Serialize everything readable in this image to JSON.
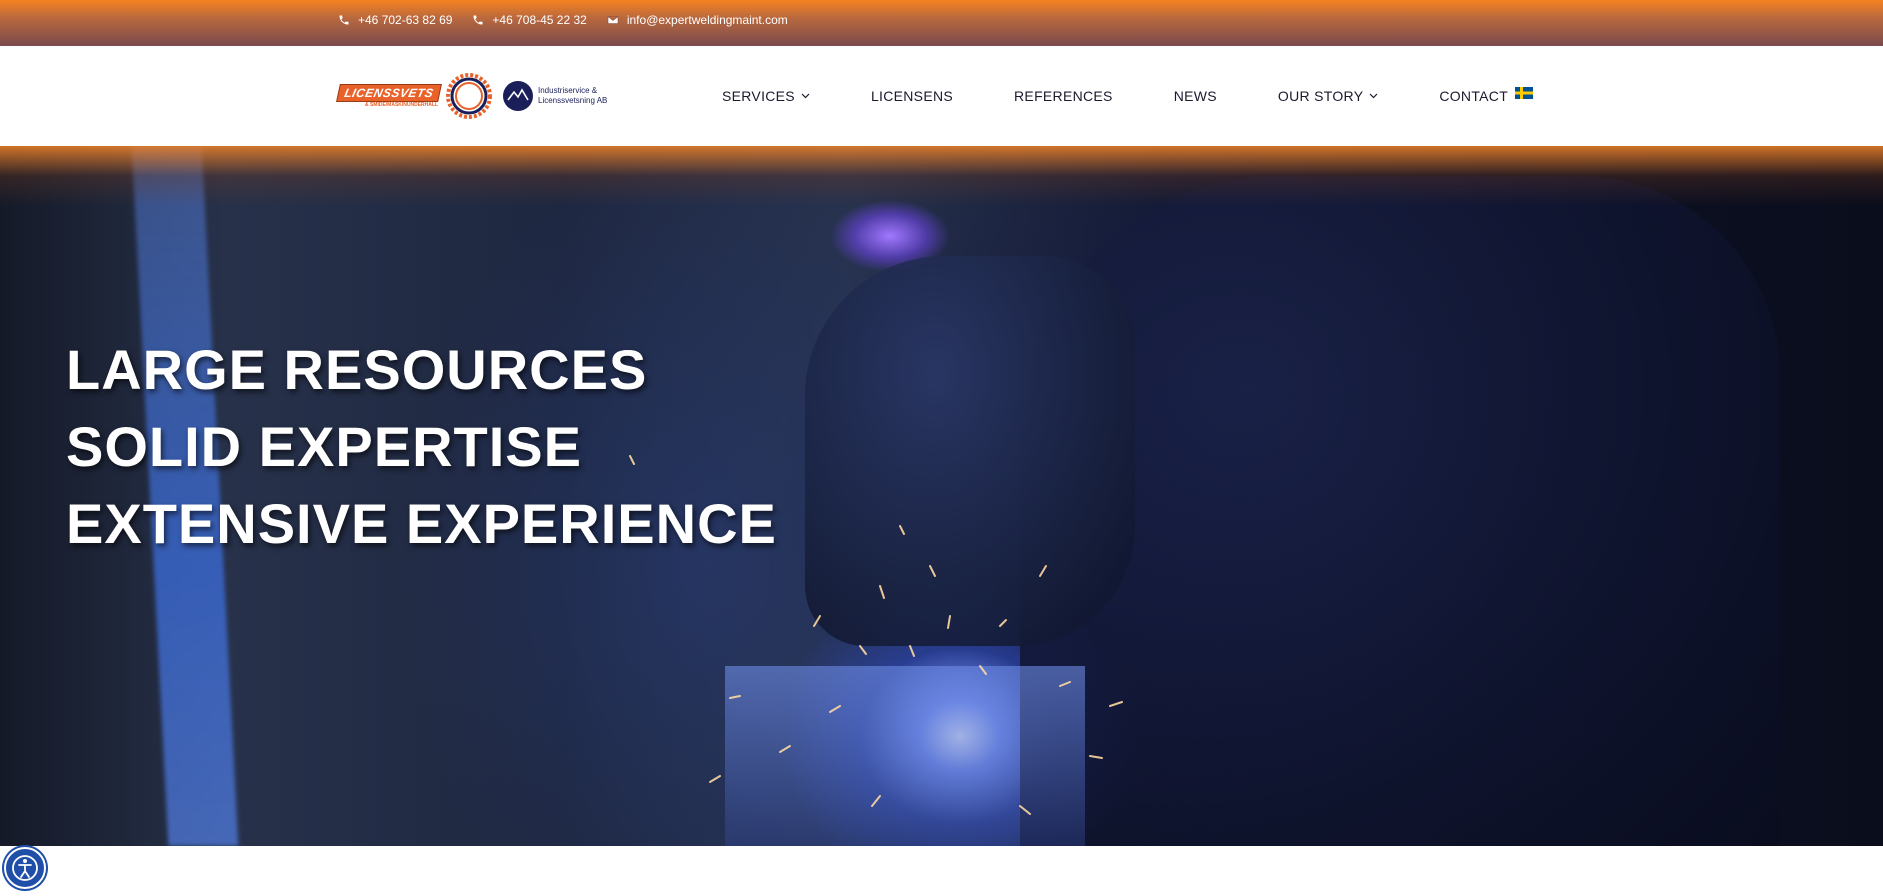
{
  "topbar": {
    "phone_1": "+46 702-63 82 69",
    "phone_2": "+46 708-45 22 32",
    "email": "info@expertweldingmaint.com",
    "icons": [
      "phone-icon",
      "phone-icon",
      "envelope-icon"
    ]
  },
  "logos": {
    "licenssvets_text": "LICENSSVETS",
    "licenssvets_subtext": "& SMIDE/MASKINUNDERHÅLL",
    "industri_text": "Industriservice & Licenssvetsning AB"
  },
  "nav": {
    "items": [
      {
        "label": "SERVICES",
        "has_dropdown": true
      },
      {
        "label": "LICENSENS",
        "has_dropdown": false
      },
      {
        "label": "REFERENCES",
        "has_dropdown": false
      },
      {
        "label": "NEWS",
        "has_dropdown": false
      },
      {
        "label": "OUR STORY",
        "has_dropdown": true
      },
      {
        "label": "CONTACT",
        "has_dropdown": false
      }
    ],
    "language_icon": "swedish-flag-icon"
  },
  "hero": {
    "lines": [
      "LARGE RESOURCES",
      "SOLID EXPERTISE",
      "EXTENSIVE EXPERIENCE"
    ]
  },
  "accessibility": {
    "icon": "accessibility-icon"
  },
  "colors": {
    "topbar_orange": "#f58220",
    "topbar_plum": "#7a4a4e",
    "nav_text": "#1a1a2e",
    "brand_orange": "#e8622a",
    "brand_navy": "#1a1f5a",
    "a11y_blue": "#1f4fa8"
  }
}
